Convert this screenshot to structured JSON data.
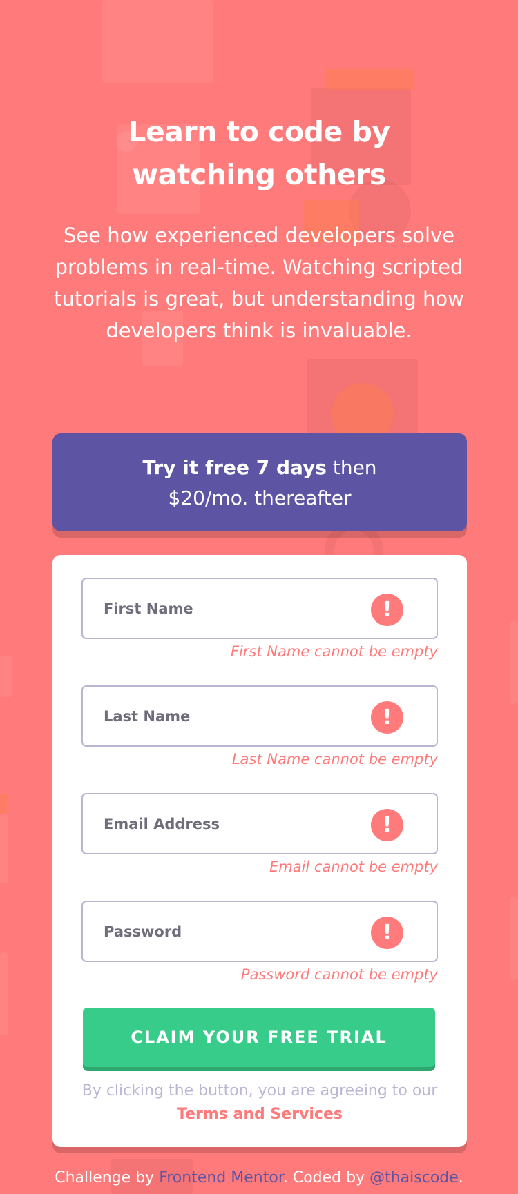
{
  "hero": {
    "title_line1": "Learn to code by",
    "title_line2": "watching others",
    "description": "See how experienced developers solve problems in real-time. Watching scripted tutorials is great, but understanding how developers think is invaluable."
  },
  "promo": {
    "bold": "Try it free 7 days",
    "rest": " then",
    "line2": "$20/mo. thereafter"
  },
  "form": {
    "fields": [
      {
        "placeholder": "First Name",
        "error": "First Name cannot be empty",
        "icon": "error-icon"
      },
      {
        "placeholder": "Last Name",
        "error": "Last Name cannot be empty",
        "icon": "error-icon"
      },
      {
        "placeholder": "Email Address",
        "error": "Email cannot be empty",
        "icon": "error-icon"
      },
      {
        "placeholder": "Password",
        "error": "Password cannot be empty",
        "icon": "error-icon"
      }
    ],
    "error_glyph": "!",
    "submit_label": "CLAIM YOUR FREE TRIAL",
    "terms_prefix": "By clicking the button, you are agreeing to our ",
    "terms_link": "Terms and Services"
  },
  "footer": {
    "challenge_by": "Challenge by ",
    "frontend_mentor": "Frontend Mentor",
    "coded_by": ". Coded by ",
    "author": "@thaiscode",
    "end": "."
  },
  "colors": {
    "background": "#ff7a7a",
    "promo": "#5e54a4",
    "cta": "#38cc8b",
    "error": "#ff7a7a"
  }
}
